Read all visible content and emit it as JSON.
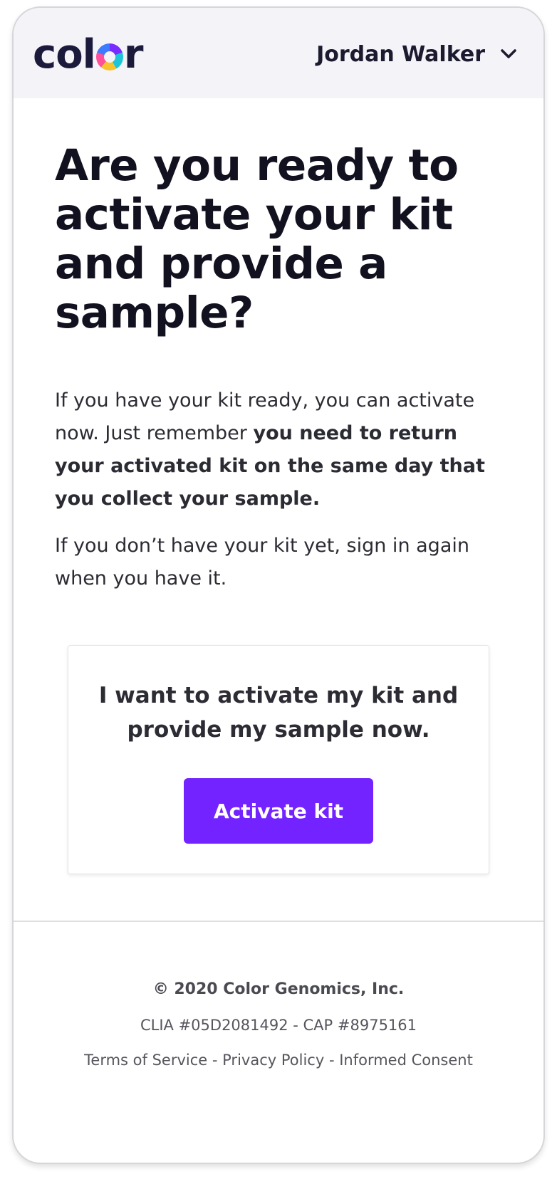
{
  "header": {
    "logo_text": "color",
    "user_name": "Jordan Walker"
  },
  "main": {
    "title": "Are you ready to activate your kit and provide a sample?",
    "paragraph1_plain": "If you have your kit ready, you can activate now. Just remember ",
    "paragraph1_bold": "you need to return your activated kit on the same day that you collect your sample.",
    "paragraph2": "If you don’t have your kit yet, sign in again when you have it."
  },
  "card": {
    "text": "I want to activate my kit and provide my sample now.",
    "button_label": "Activate kit"
  },
  "footer": {
    "copyright": "© 2020 Color Genomics, Inc.",
    "certifications": "CLIA #05D2081492 - CAP #8975161",
    "links": [
      {
        "label": "Terms of Service"
      },
      {
        "label": "Privacy Policy"
      },
      {
        "label": "Informed Consent"
      }
    ],
    "separator": " - "
  },
  "colors": {
    "header_bg": "#f3f3f8",
    "brand_dark": "#1b1a3c",
    "accent": "#7323ff"
  },
  "icons": {
    "user_menu": "chevron-down-icon",
    "logo_mark": "color-ring-logo"
  }
}
